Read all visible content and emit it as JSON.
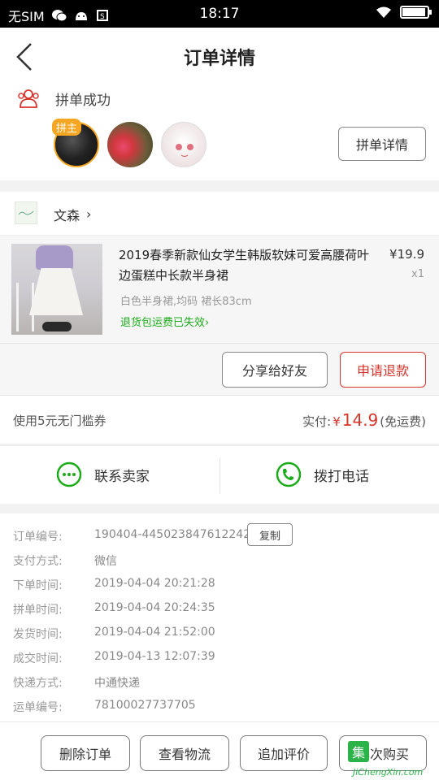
{
  "status_bar": {
    "carrier": "无SIM",
    "time": "18:17",
    "battery_level": 0.95
  },
  "header": {
    "title": "订单详情"
  },
  "group": {
    "status": "拼单成功",
    "leader_tag": "拼主",
    "details_button": "拼单详情"
  },
  "shop": {
    "name": "文森",
    "chevron": "›"
  },
  "product": {
    "title": "2019春季新款仙女学生韩版软妹可爱高腰荷叶边蛋糕中长款半身裙",
    "price": "¥19.9",
    "quantity": "x1",
    "spec": "白色半身裙,均码 裙长83cm",
    "return_note": "退货包运费已失效›"
  },
  "product_actions": {
    "share": "分享给好友",
    "refund": "申请退款"
  },
  "summary": {
    "coupon": "使用5元无门槛券",
    "paid_label": "实付:",
    "currency": "¥",
    "paid_amount": "14.9",
    "shipping_note": "(免运费)"
  },
  "contact": {
    "seller": "联系卖家",
    "call": "拨打电话"
  },
  "order_info": {
    "rows": [
      {
        "label": "订单编号:",
        "value": "190404-445023847612242"
      },
      {
        "label": "支付方式:",
        "value": "微信"
      },
      {
        "label": "下单时间:",
        "value": "2019-04-04 20:21:28"
      },
      {
        "label": "拼单时间:",
        "value": "2019-04-04 20:24:35"
      },
      {
        "label": "发货时间:",
        "value": "2019-04-04 21:52:00"
      },
      {
        "label": "成交时间:",
        "value": "2019-04-13 12:07:39"
      },
      {
        "label": "快递方式:",
        "value": "中通快递"
      },
      {
        "label": "运单编号:",
        "value": "78100027737705"
      }
    ],
    "copy_button": "复制"
  },
  "bottom_bar": {
    "delete": "删除订单",
    "logistics": "查看物流",
    "review": "追加评价",
    "rebuy": "再次购买"
  },
  "watermark": {
    "logo_char": "集",
    "text": "JiChengXin.com"
  },
  "colors": {
    "accent_red": "#d9342b",
    "wechat_green": "#1aad19",
    "leader_orange": "#f5a623"
  }
}
